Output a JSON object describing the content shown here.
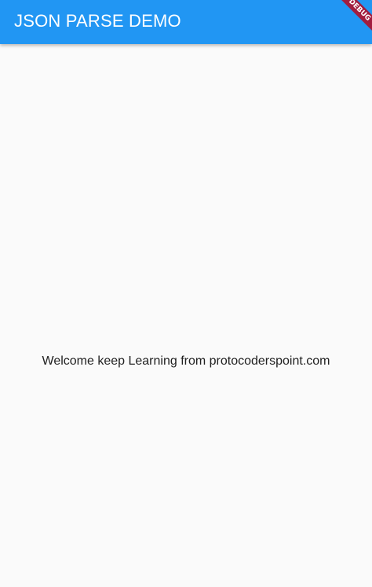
{
  "app_bar": {
    "title": "JSON PARSE DEMO",
    "color": "#2196f3"
  },
  "debug_banner": {
    "label": "DEBUG",
    "color": "#a21d3f"
  },
  "main": {
    "welcome_text": "Welcome keep Learning from protocoderspoint.com",
    "background": "#fafafa"
  }
}
